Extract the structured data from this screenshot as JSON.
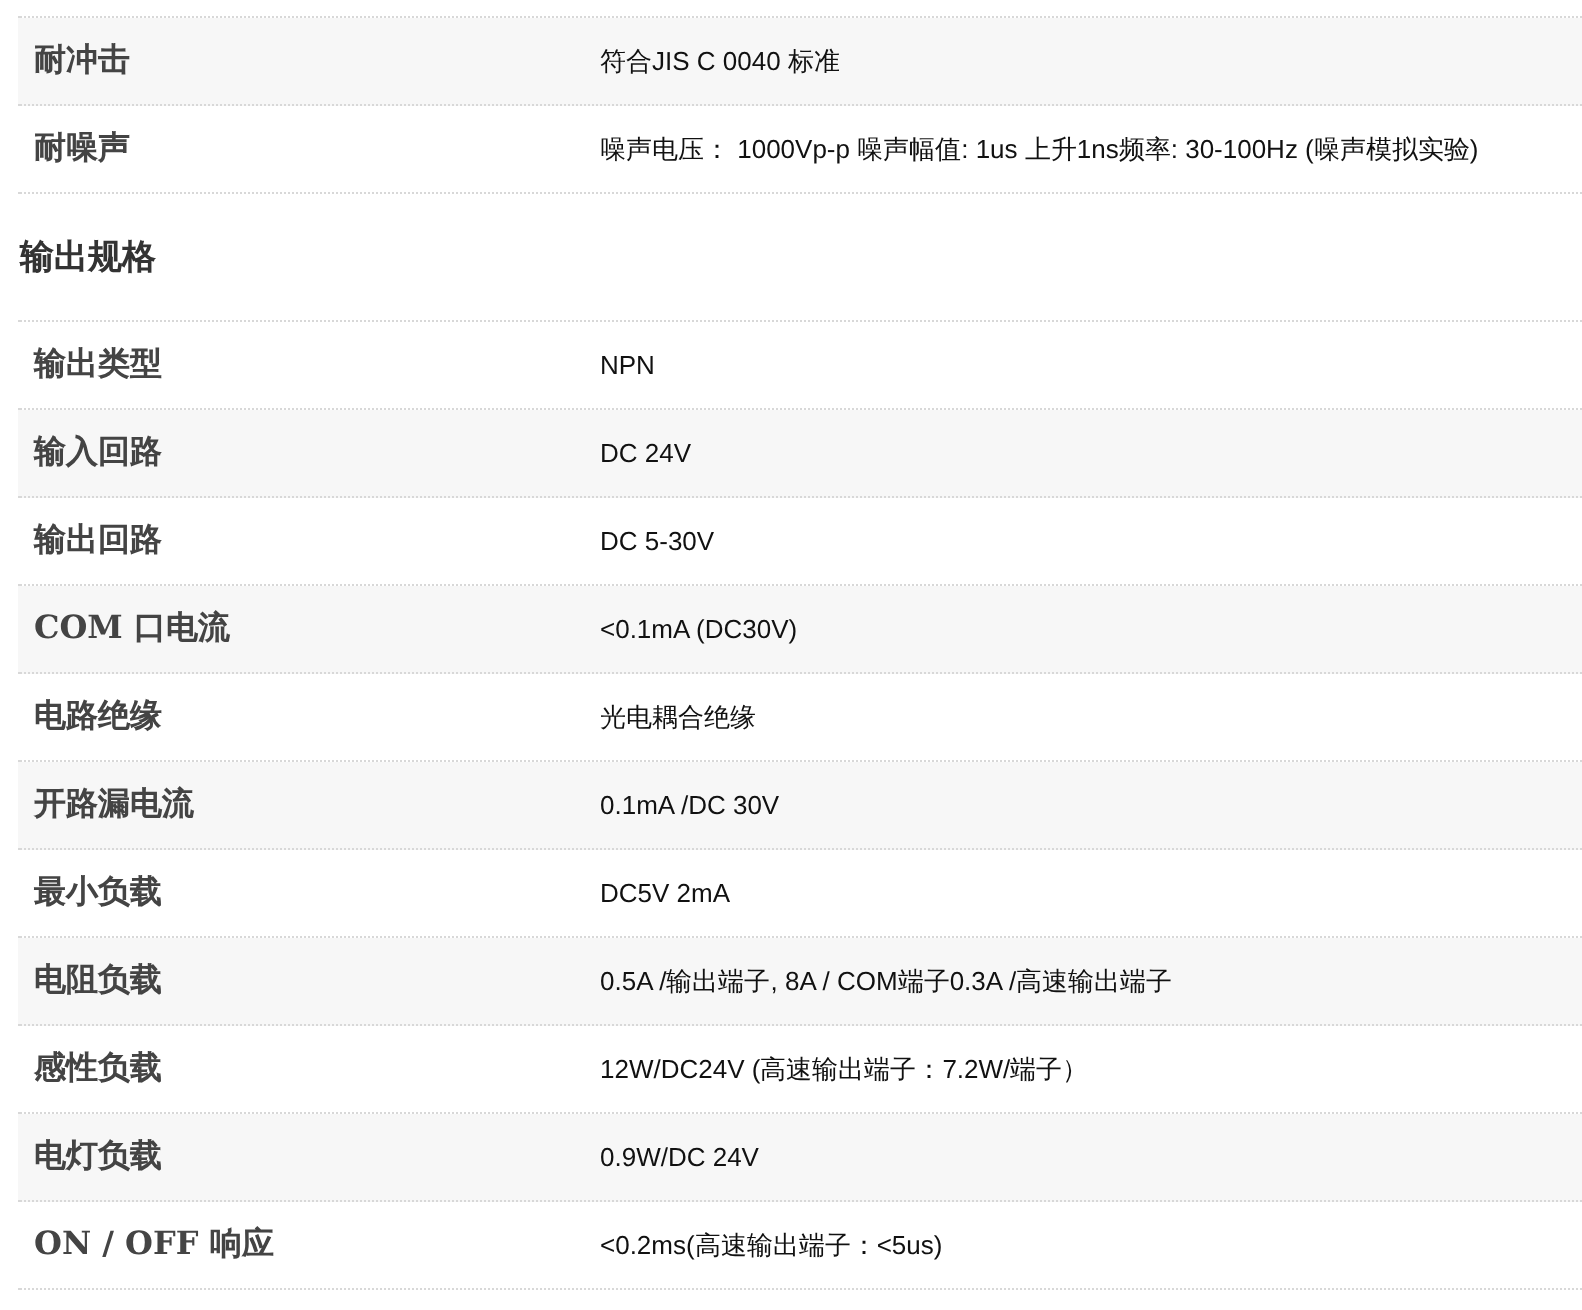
{
  "sections": [
    {
      "rows": [
        {
          "label": "耐冲击",
          "value": "符合JIS C 0040 标准"
        },
        {
          "label": "耐噪声",
          "value": "噪声电压： 1000Vp-p 噪声幅值: 1us 上升1ns频率: 30-100Hz (噪声模拟实验)"
        }
      ]
    },
    {
      "heading": "输出规格",
      "rows": [
        {
          "label": "输出类型",
          "value": "NPN"
        },
        {
          "label": "输入回路",
          "value": "DC 24V"
        },
        {
          "label": "输出回路",
          "value": "DC 5-30V"
        },
        {
          "label": "COM 口电流",
          "value": "<0.1mA (DC30V)"
        },
        {
          "label": "电路绝缘",
          "value": "光电耦合绝缘"
        },
        {
          "label": "开路漏电流",
          "value": "0.1mA /DC 30V"
        },
        {
          "label": "最小负载",
          "value": "DC5V 2mA"
        },
        {
          "label": "电阻负载",
          "value": "0.5A /输出端子, 8A / COM端子0.3A /高速输出端子"
        },
        {
          "label": "感性负载",
          "value": "12W/DC24V (高速输出端子：7.2W/端子）"
        },
        {
          "label": "电灯负载",
          "value": "0.9W/DC 24V"
        },
        {
          "label": "ON / OFF 响应",
          "value": "<0.2ms(高速输出端子：<5us)"
        }
      ]
    }
  ]
}
